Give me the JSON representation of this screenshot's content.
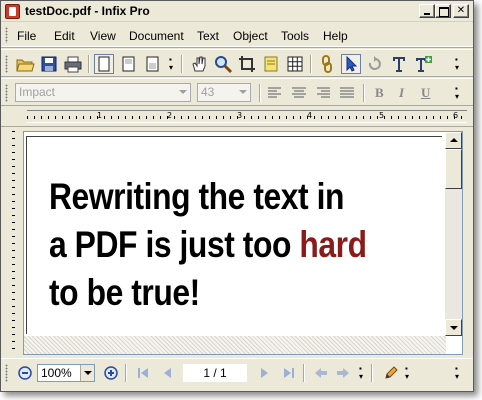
{
  "window": {
    "title": "testDoc.pdf - Infix Pro"
  },
  "menu": {
    "items": [
      "File",
      "Edit",
      "View",
      "Document",
      "Text",
      "Object",
      "Tools",
      "Help"
    ]
  },
  "toolbar": {
    "icons": [
      "open-folder-icon",
      "save-icon",
      "print-icon",
      "single-page-icon",
      "two-page-icon",
      "continuous-page-icon",
      "hand-tool-icon",
      "zoom-tool-icon",
      "crop-icon",
      "notes-icon",
      "grid-icon",
      "link-icon",
      "select-arrow-icon",
      "rotate-icon",
      "text-tool-icon",
      "add-text-icon"
    ]
  },
  "format_toolbar": {
    "font_name": "Impact",
    "font_size": "43",
    "bold_label": "B",
    "italic_label": "I",
    "underline_label": "U"
  },
  "ruler": {
    "numbers": [
      "1",
      "2",
      "3",
      "4",
      "5",
      "6"
    ]
  },
  "document": {
    "line1": "Rewriting the text in",
    "line2_start": "a PDF is just too ",
    "line2_highlight": "hard",
    "line3": "to be true!",
    "highlight_color": "#8b1a1a"
  },
  "statusbar": {
    "zoom": "100%",
    "page": "1 / 1"
  }
}
